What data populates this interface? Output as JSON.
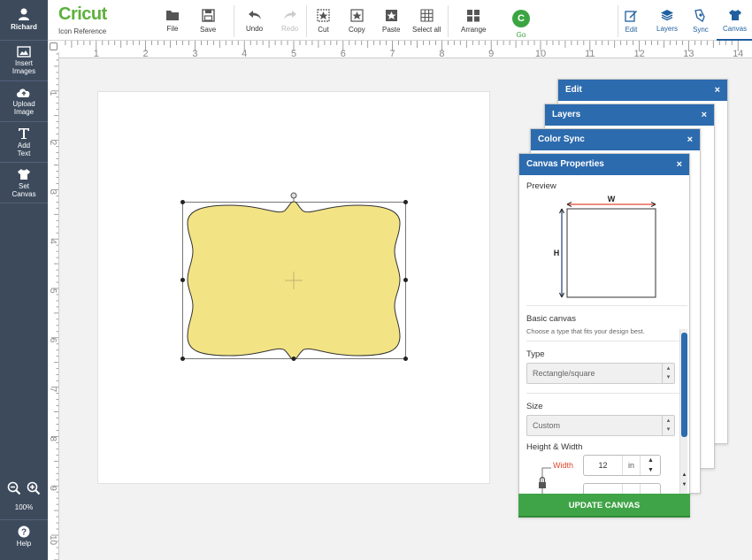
{
  "user": {
    "name": "Richard"
  },
  "sidebar": {
    "items": [
      {
        "label1": "Insert",
        "label2": "Images",
        "icon": "image-icon"
      },
      {
        "label1": "Upload",
        "label2": "Image",
        "icon": "cloud-upload-icon"
      },
      {
        "label1": "Add",
        "label2": "Text",
        "icon": "text-icon"
      },
      {
        "label1": "Set",
        "label2": "Canvas",
        "icon": "tshirt-icon"
      }
    ],
    "zoom": "100%",
    "help": "Help"
  },
  "toolbar": {
    "brand": "Cricut",
    "subtitle": "Icon Reference",
    "file": "File",
    "save": "Save",
    "undo": "Undo",
    "redo": "Redo",
    "cut": "Cut",
    "copy": "Copy",
    "paste": "Paste",
    "select_all": "Select all",
    "arrange": "Arrange",
    "go": "Go",
    "edit": "Edit",
    "layers": "Layers",
    "sync": "Sync",
    "canvas": "Canvas"
  },
  "rulers": {
    "horizontal": [
      "1",
      "2",
      "3",
      "4",
      "5",
      "6",
      "7",
      "8",
      "9",
      "10",
      "11",
      "12",
      "13",
      "14"
    ],
    "vertical": [
      "1",
      "2",
      "3",
      "4",
      "5",
      "6",
      "7",
      "8",
      "9",
      "10"
    ]
  },
  "panels": {
    "edit": "Edit",
    "layers": "Layers",
    "color_sync": "Color Sync",
    "canvas_properties": "Canvas Properties",
    "close": "×"
  },
  "canvas_props": {
    "preview": "Preview",
    "w_label": "W",
    "h_label": "H",
    "basic_canvas": "Basic canvas",
    "basic_hint": "Choose a type that fits your design best.",
    "type_label": "Type",
    "type_value": "Rectangle/square",
    "size_label": "Size",
    "size_value": "Custom",
    "hw_label": "Height & Width",
    "width_label": "Width",
    "width_value": "12",
    "unit": "in",
    "update_button": "UPDATE CANVAS"
  },
  "colors": {
    "sidebar": "#3c4a5c",
    "brand_green": "#5cb03c",
    "panel_blue": "#2c6bae",
    "shape_fill": "#f2e385",
    "update_green": "#3fa447",
    "width_label": "#e0492d"
  }
}
